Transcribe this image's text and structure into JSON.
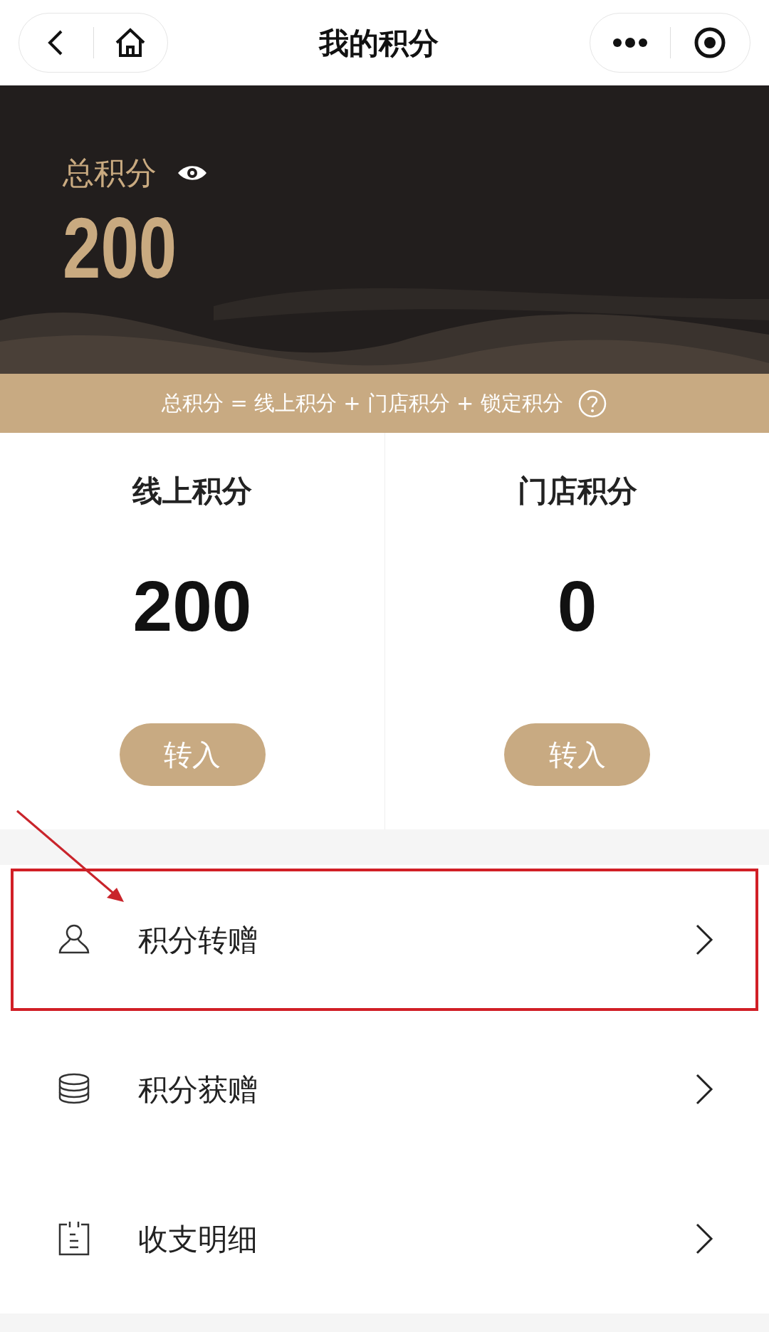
{
  "nav": {
    "title": "我的积分"
  },
  "summary": {
    "label": "总积分",
    "points": "200",
    "formula": "总积分 = 线上积分 + 门店积分 + 锁定积分"
  },
  "accounts": [
    {
      "title": "线上积分",
      "points": "200",
      "button": "转入"
    },
    {
      "title": "门店积分",
      "points": "0",
      "button": "转入"
    }
  ],
  "menu": [
    {
      "label": "积分转赠",
      "kind": "person",
      "highlighted": true
    },
    {
      "label": "积分获赠",
      "kind": "coins",
      "highlighted": false
    },
    {
      "label": "收支明细",
      "kind": "clipboard",
      "highlighted": false
    }
  ]
}
